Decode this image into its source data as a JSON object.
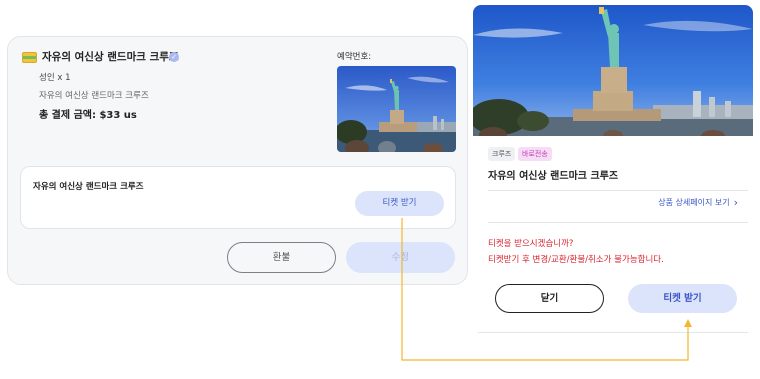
{
  "booking": {
    "title": "자유의 여신상 랜드마크 크루즈",
    "quantity": "성인 x 1",
    "subtitle": "자유의 여신상 랜드마크 크루즈",
    "total": "총 결제 금액: $33 us",
    "reservation_label": "예약번호:",
    "inner_title": "자유의 여신상 랜드마크 크루즈",
    "ticket_button": "티켓 받기",
    "refund_button": "환불",
    "edit_button": "수정"
  },
  "modal": {
    "tags": [
      "크루즈",
      "바로전송"
    ],
    "title": "자유의 여신상 랜드마크 크루즈",
    "detail_link": "상품 상세페이지 보기",
    "warning_line1": "티켓을 받으시겠습니까?",
    "warning_line2": "티켓받기 후 변경/교환/환불/취소가 불가능합니다.",
    "close_button": "닫기",
    "ticket_button": "티켓 받기"
  },
  "icons": {
    "ticket": "ticket-icon",
    "verified": "verified-badge-icon",
    "chevron": "chevron-right-icon"
  },
  "colors": {
    "accent": "#3b55c9",
    "button_light": "#dbe4fb",
    "warning": "#d9232d",
    "connector": "#f2b630",
    "tag_instant": "#c13bb5"
  }
}
